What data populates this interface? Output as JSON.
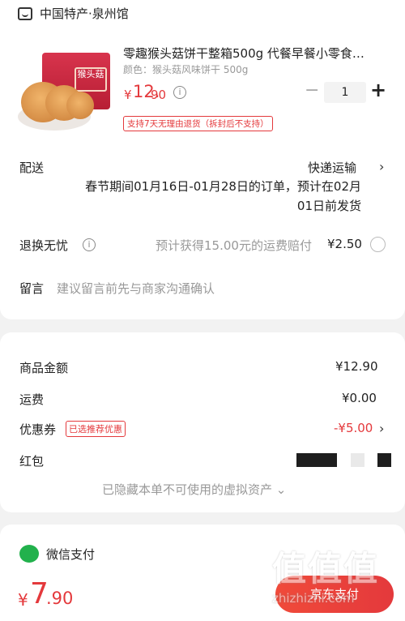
{
  "shop": {
    "name": "中国特产·泉州馆",
    "icon": "shop-icon"
  },
  "product": {
    "title": "零趣猴头菇饼干整箱500g 代餐早餐小零食…",
    "spec": "颜色：猴头菇风味饼干 500g",
    "image_text": "猴头菇",
    "price_symbol": "¥",
    "price_int": "12.",
    "price_dec": "90",
    "quantity": "1",
    "minus_label": "−",
    "plus_label": "+",
    "return_policy": "支持7天无理由退货（拆封后不支持）"
  },
  "delivery": {
    "label": "配送",
    "method": "快递运输",
    "note_line1": "春节期间01月16日-01月28日的订单，预计在02月",
    "note_line2": "01日前发货"
  },
  "return_insurance": {
    "label": "退换无忧",
    "desc": "预计获得15.00元的运费赔付",
    "price": "¥2.50"
  },
  "message": {
    "label": "留言",
    "placeholder": "建议留言前先与商家沟通确认"
  },
  "summary": {
    "goods_label": "商品金额",
    "goods_value": "¥12.90",
    "shipping_label": "运费",
    "shipping_value": "¥0.00",
    "coupon_label": "优惠券",
    "coupon_tag": "已选推荐优惠",
    "coupon_value": "-¥5.00",
    "redpacket_label": "红包",
    "hidden_note": "已隐藏本单不可使用的虚拟资产 ⌄"
  },
  "payment": {
    "method_label": "微信支付",
    "icon": "wechat-icon"
  },
  "footer": {
    "total_symbol": "¥",
    "total_int": "7",
    "total_dec": ".90",
    "pay_button": "京东支付"
  },
  "watermark": {
    "glyphs": "值值值",
    "url": "zhizhizhi.com"
  },
  "colors": {
    "accent": "#e4393c",
    "wechat": "#22b14c",
    "background": "#f2f2f2"
  }
}
